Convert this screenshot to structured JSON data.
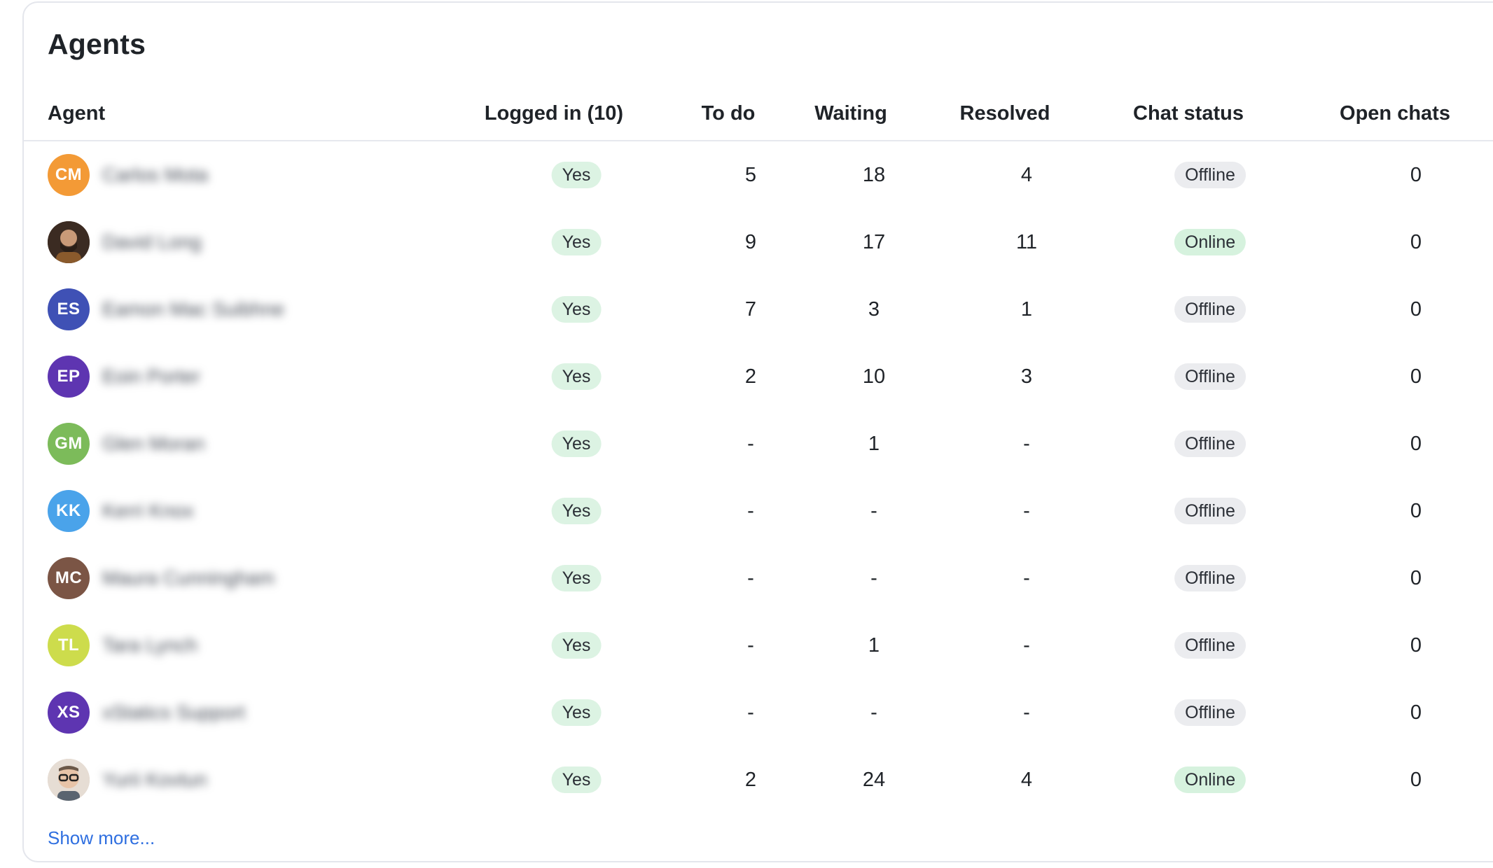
{
  "card": {
    "title": "Agents"
  },
  "table": {
    "columns": {
      "agent": "Agent",
      "logged_in": "Logged in (10)",
      "to_do": "To do",
      "waiting": "Waiting",
      "resolved": "Resolved",
      "chat_status": "Chat status",
      "open_chats": "Open chats"
    },
    "rows": [
      {
        "initials": "CM",
        "avatar_color": "#f39a36",
        "avatar_type": "initials",
        "name": "Carlos Mota",
        "logged_in": "Yes",
        "to_do": "5",
        "waiting": "18",
        "resolved": "4",
        "chat_status": "Offline",
        "open_chats": "0"
      },
      {
        "initials": "",
        "avatar_color": "#6b4a35",
        "avatar_type": "photo",
        "name": "David Long",
        "logged_in": "Yes",
        "to_do": "9",
        "waiting": "17",
        "resolved": "11",
        "chat_status": "Online",
        "open_chats": "0"
      },
      {
        "initials": "ES",
        "avatar_color": "#3f51b5",
        "avatar_type": "initials",
        "name": "Eamon Mac Suibhne",
        "logged_in": "Yes",
        "to_do": "7",
        "waiting": "3",
        "resolved": "1",
        "chat_status": "Offline",
        "open_chats": "0"
      },
      {
        "initials": "EP",
        "avatar_color": "#5e35b1",
        "avatar_type": "initials",
        "name": "Eoin Porter",
        "logged_in": "Yes",
        "to_do": "2",
        "waiting": "10",
        "resolved": "3",
        "chat_status": "Offline",
        "open_chats": "0"
      },
      {
        "initials": "GM",
        "avatar_color": "#7cbb5a",
        "avatar_type": "initials",
        "name": "Glen Moran",
        "logged_in": "Yes",
        "to_do": "-",
        "waiting": "1",
        "resolved": "-",
        "chat_status": "Offline",
        "open_chats": "0"
      },
      {
        "initials": "KK",
        "avatar_color": "#4aa3ea",
        "avatar_type": "initials",
        "name": "Kerri Knox",
        "logged_in": "Yes",
        "to_do": "-",
        "waiting": "-",
        "resolved": "-",
        "chat_status": "Offline",
        "open_chats": "0"
      },
      {
        "initials": "MC",
        "avatar_color": "#7b5545",
        "avatar_type": "initials",
        "name": "Maura Cunningham",
        "logged_in": "Yes",
        "to_do": "-",
        "waiting": "-",
        "resolved": "-",
        "chat_status": "Offline",
        "open_chats": "0"
      },
      {
        "initials": "TL",
        "avatar_color": "#cddc4c",
        "avatar_type": "initials",
        "name": "Tara Lynch",
        "logged_in": "Yes",
        "to_do": "-",
        "waiting": "1",
        "resolved": "-",
        "chat_status": "Offline",
        "open_chats": "0"
      },
      {
        "initials": "XS",
        "avatar_color": "#5e35b1",
        "avatar_type": "initials",
        "name": "xStatics Support",
        "logged_in": "Yes",
        "to_do": "-",
        "waiting": "-",
        "resolved": "-",
        "chat_status": "Offline",
        "open_chats": "0"
      },
      {
        "initials": "",
        "avatar_color": "#d9c7b8",
        "avatar_type": "photo-glasses",
        "name": "Yurii Kovtun",
        "logged_in": "Yes",
        "to_do": "2",
        "waiting": "24",
        "resolved": "4",
        "chat_status": "Online",
        "open_chats": "0"
      }
    ]
  },
  "footer": {
    "show_more": "Show more..."
  }
}
